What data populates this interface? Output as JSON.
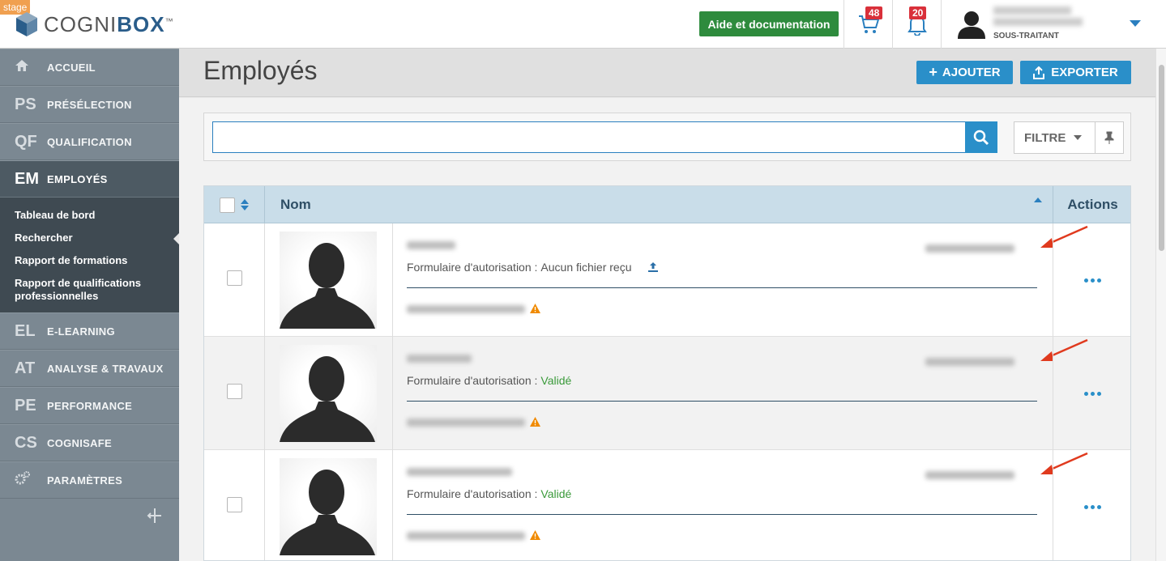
{
  "header": {
    "env_tag": "stage",
    "logo_text_a": "COGNI",
    "logo_text_b": "BOX",
    "logo_tm": "™",
    "help_label": "Aide et documentation",
    "cart_count": "48",
    "notif_count": "20",
    "user_role": "SOUS-TRAITANT"
  },
  "sidebar": {
    "items": [
      {
        "abbr": "",
        "label": "ACCUEIL"
      },
      {
        "abbr": "PS",
        "label": "PRÉSÉLECTION"
      },
      {
        "abbr": "QF",
        "label": "QUALIFICATION"
      },
      {
        "abbr": "EM",
        "label": "EMPLOYÉS"
      },
      {
        "abbr": "EL",
        "label": "E-LEARNING"
      },
      {
        "abbr": "AT",
        "label": "ANALYSE & TRAVAUX"
      },
      {
        "abbr": "PE",
        "label": "PERFORMANCE"
      },
      {
        "abbr": "CS",
        "label": "COGNISAFE"
      },
      {
        "abbr": "",
        "label": "PARAMÈTRES"
      }
    ],
    "subnav": [
      "Tableau de bord",
      "Rechercher",
      "Rapport de formations",
      "Rapport de qualifications professionnelles"
    ]
  },
  "page": {
    "title": "Employés",
    "add_label": "AJOUTER",
    "export_label": "EXPORTER"
  },
  "search": {
    "value": "",
    "filter_label": "FILTRE"
  },
  "table": {
    "col_name": "Nom",
    "col_actions": "Actions",
    "rows": [
      {
        "auth_label": "Formulaire d'autorisation :",
        "auth_status": "Aucun fichier reçu",
        "auth_state": "none"
      },
      {
        "auth_label": "Formulaire d'autorisation :",
        "auth_status": "Validé",
        "auth_state": "ok"
      },
      {
        "auth_label": "Formulaire d'autorisation :",
        "auth_status": "Validé",
        "auth_state": "ok"
      }
    ]
  },
  "colors": {
    "accent": "#2a8fc9",
    "help_green": "#2e8b3d",
    "badge_red": "#d9303a",
    "valid_green": "#3a9a3a",
    "warning_orange": "#f08a00",
    "annotation_red": "#e03a1e"
  }
}
